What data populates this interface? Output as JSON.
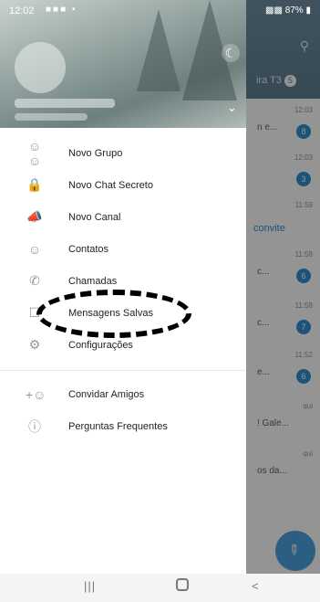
{
  "status_bar": {
    "time": "12:02",
    "battery": "87%"
  },
  "drawer": {
    "menu_items": [
      {
        "label": "Novo Grupo",
        "icon": "group-icon"
      },
      {
        "label": "Novo Chat Secreto",
        "icon": "lock-icon"
      },
      {
        "label": "Novo Canal",
        "icon": "megaphone-icon"
      },
      {
        "label": "Contatos",
        "icon": "person-icon"
      },
      {
        "label": "Chamadas",
        "icon": "phone-icon"
      },
      {
        "label": "Mensagens Salvas",
        "icon": "bookmark-icon"
      },
      {
        "label": "Configurações",
        "icon": "gear-icon"
      }
    ],
    "secondary_items": [
      {
        "label": "Convidar Amigos",
        "icon": "add-person-icon"
      },
      {
        "label": "Perguntas Frequentes",
        "icon": "help-icon"
      }
    ]
  },
  "background_chat_list": {
    "tab_label": "ira T3",
    "tab_badge": "5",
    "rows": [
      {
        "time": "12:03",
        "snippet": "n e...",
        "badge": "8"
      },
      {
        "time": "12:03",
        "snippet": "",
        "badge": "3"
      },
      {
        "time": "11:59",
        "snippet": "convite",
        "badge": ""
      },
      {
        "time": "11:58",
        "snippet": "c...",
        "badge": "6"
      },
      {
        "time": "11:58",
        "snippet": "c...",
        "badge": "7"
      },
      {
        "time": "11:52",
        "snippet": "e...",
        "badge": "6"
      },
      {
        "time": "qui",
        "snippet": "! Gale...",
        "badge": ""
      },
      {
        "time": "qui",
        "snippet": "os da...",
        "badge": ""
      }
    ]
  },
  "colors": {
    "accent_blue": "#2f8fd1",
    "toolbar": "#5d7e91",
    "annotation": "#000000"
  }
}
